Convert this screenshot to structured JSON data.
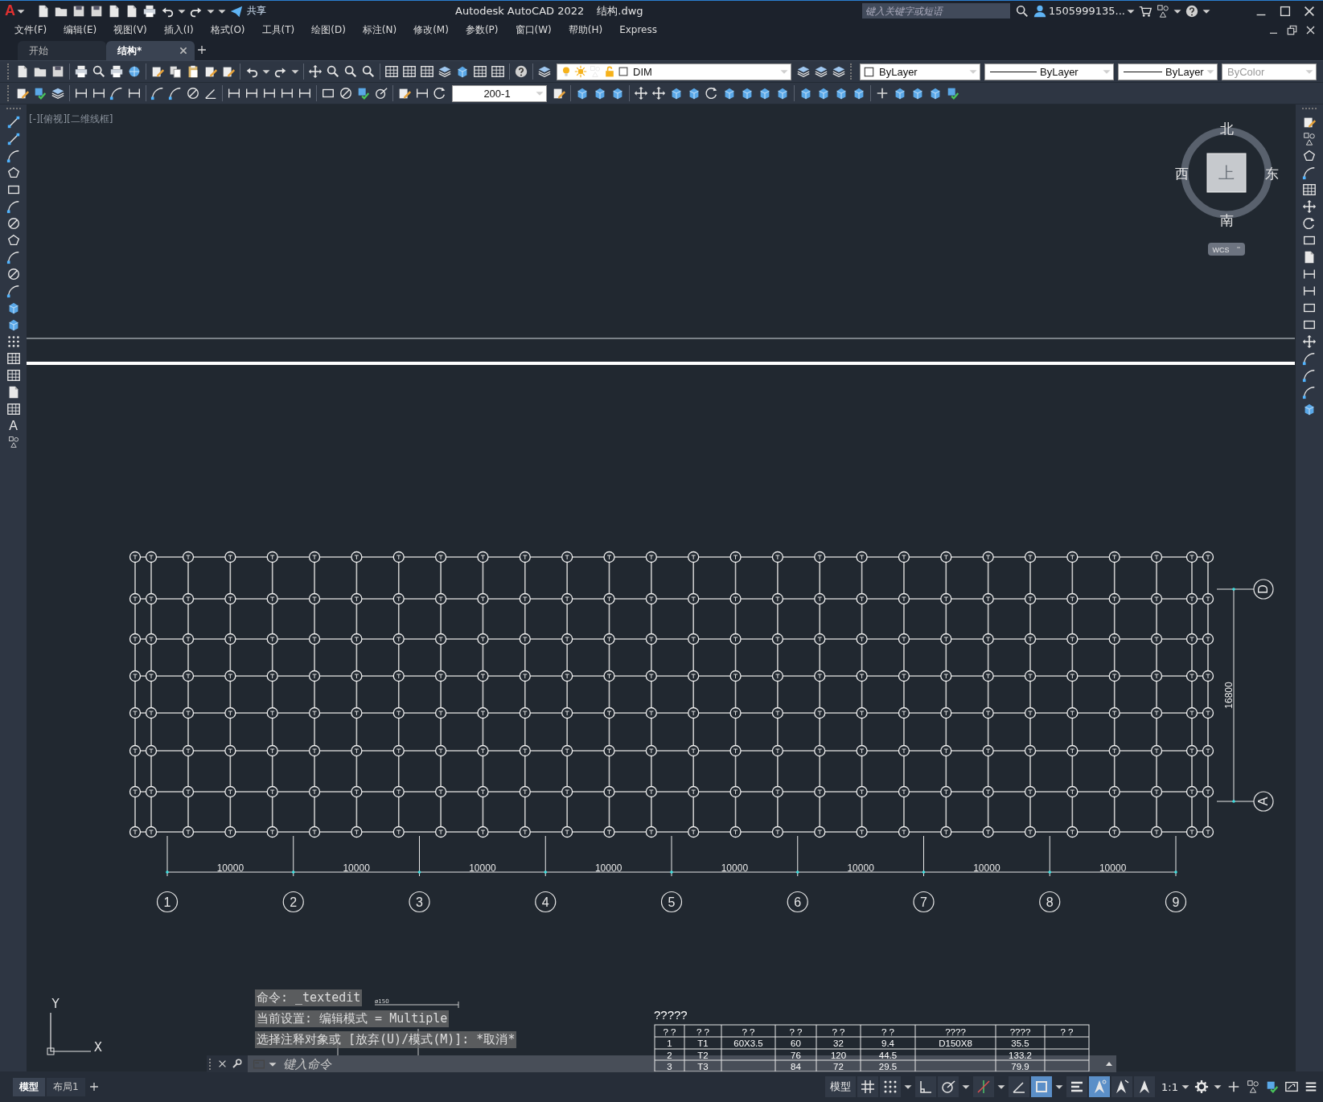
{
  "title_bar": {
    "logo": "A",
    "share": "共享",
    "title": "Autodesk AutoCAD 2022",
    "file_name": "结构.dwg",
    "search": {
      "placeholder": "键入关键字或短语"
    },
    "user": "1505999135..."
  },
  "menu": [
    "文件(F)",
    "编辑(E)",
    "视图(V)",
    "插入(I)",
    "格式(O)",
    "工具(T)",
    "绘图(D)",
    "标注(N)",
    "修改(M)",
    "参数(P)",
    "窗口(W)",
    "帮助(H)",
    "Express"
  ],
  "tabs": [
    {
      "label": "开始",
      "selected": false,
      "closable": false
    },
    {
      "label": "结构*",
      "selected": true,
      "closable": true
    }
  ],
  "properties": {
    "layer": "DIM",
    "color_label": "ByLayer",
    "linetype": "ByLayer",
    "lineweight": "ByLayer",
    "plot_style": {
      "value": "ByColor",
      "disabled": true
    },
    "dim_style": "200-1"
  },
  "text_tool": "A",
  "viewport_label": "[-][俯视][二维线框]",
  "viewcube": {
    "north": "北",
    "south": "南",
    "west": "西",
    "east": "东",
    "face": "上",
    "ucs": "WCS"
  },
  "drawing": {
    "column_axes": [
      "1",
      "2",
      "3",
      "4",
      "5",
      "6",
      "7",
      "8",
      "9"
    ],
    "spacings": [
      "10000",
      "10000",
      "10000",
      "10000",
      "10000",
      "10000",
      "10000",
      "10000"
    ],
    "row_axes": [
      "D",
      "A"
    ],
    "row_span": "16800",
    "pipe_label": "ø150",
    "ucs_x": "X",
    "ucs_y": "Y"
  },
  "table": {
    "title": "?????",
    "columns": [
      "? ?",
      "? ?",
      "? ?",
      "? ?",
      "? ?",
      "? ?",
      "????",
      "????",
      "? ?"
    ],
    "rows": [
      [
        "1",
        "T1",
        "60X3.5",
        "60",
        "32",
        "9.4",
        "D150X8",
        "35.5",
        null
      ],
      [
        "2",
        "T2",
        null,
        "76",
        "120",
        "44.5",
        null,
        "133.2",
        null
      ],
      [
        "3",
        "T3",
        null,
        "84",
        "72",
        "29.5",
        null,
        "79.9",
        null
      ]
    ]
  },
  "command": {
    "history": [
      "命令: _textedit",
      "当前设置: 编辑模式 = Multiple",
      "选择注释对象或 [放弃(U)/模式(M)]: *取消*"
    ],
    "placeholder": "键入命令"
  },
  "layout_tabs": [
    {
      "label": "模型",
      "selected": true
    },
    {
      "label": "布局1",
      "selected": false
    }
  ],
  "status_bar": {
    "space": "模型",
    "scale": "1:1",
    "toggles": [
      {
        "kind": "grid",
        "on": false
      },
      {
        "kind": "snap",
        "on": false
      },
      {
        "kind": "ortho",
        "on": false
      },
      {
        "kind": "polar",
        "on": false
      },
      {
        "kind": "tracking",
        "on": false
      },
      {
        "kind": "angle",
        "on": false
      },
      {
        "kind": "object_snap",
        "on": true
      },
      {
        "kind": "lineweight",
        "on": false
      },
      {
        "kind": "annotation_visibility",
        "on": true
      },
      {
        "kind": "auto_scale",
        "on": false
      },
      {
        "kind": "annotation_scale",
        "on": false
      }
    ]
  }
}
